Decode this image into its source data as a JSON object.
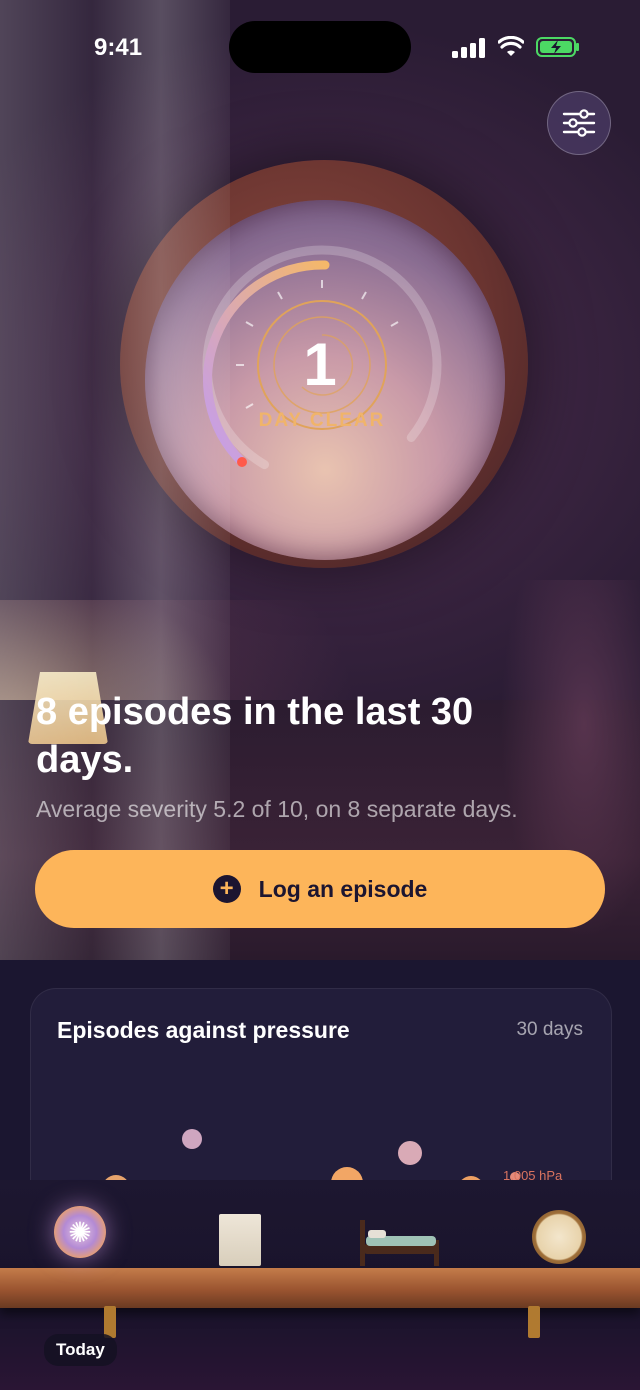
{
  "status_bar": {
    "time": "9:41"
  },
  "streak": {
    "count": "1",
    "label": "DAY CLEAR",
    "progress": 0.55
  },
  "summary": {
    "headline": "8 episodes in the last 30 days.",
    "subtext": "Average severity 5.2 of 10, on 8 separate days."
  },
  "log_button": {
    "label": "Log an episode"
  },
  "chart_card": {
    "title": "Episodes against pressure",
    "range": "30 days"
  },
  "chart_data": {
    "type": "scatter",
    "title": "Episodes against pressure",
    "annotation": "1,005 hPa",
    "points_visible": 6
  },
  "tabs": [
    {
      "label": "Today",
      "icon": "swirl-icon",
      "active": true
    },
    {
      "label": "",
      "icon": "note-icon",
      "active": false
    },
    {
      "label": "",
      "icon": "bed-icon",
      "active": false
    },
    {
      "label": "",
      "icon": "barometer-icon",
      "active": false
    }
  ],
  "colors": {
    "accent": "#fdb55a",
    "card": "#221d3a",
    "background": "#1b1630"
  }
}
